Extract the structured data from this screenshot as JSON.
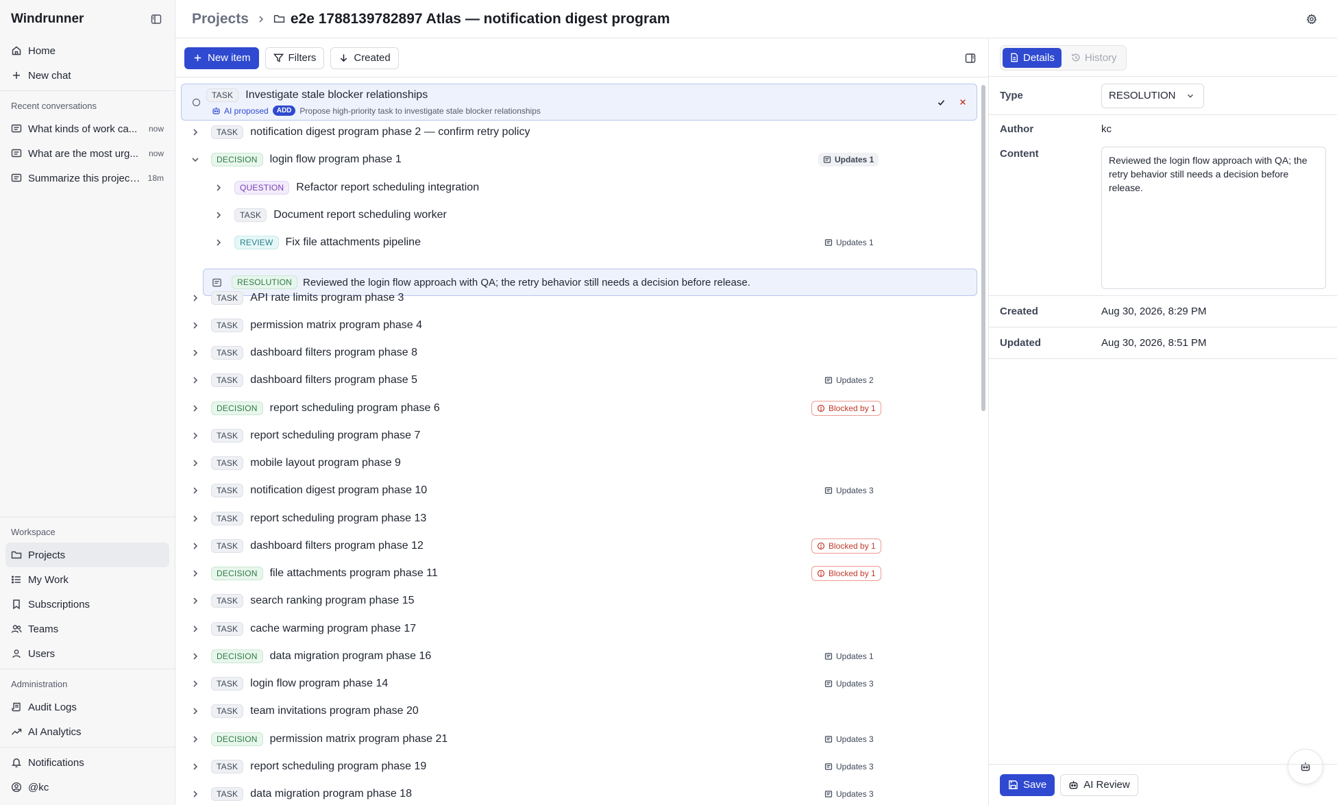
{
  "app": {
    "brand": "Windrunner"
  },
  "sidebar": {
    "home": "Home",
    "new_chat": "New chat",
    "recent_label": "Recent conversations",
    "conversations": [
      {
        "title": "What kinds of work ca...",
        "time": "now"
      },
      {
        "title": "What are the most urg...",
        "time": "now"
      },
      {
        "title": "Summarize this project ...",
        "time": "18m"
      }
    ],
    "workspace_label": "Workspace",
    "workspace": [
      "Projects",
      "My Work",
      "Subscriptions",
      "Teams",
      "Users"
    ],
    "admin_label": "Administration",
    "admin": [
      "Audit Logs",
      "AI Analytics"
    ],
    "notifications": "Notifications",
    "user": "@kc"
  },
  "header": {
    "root": "Projects",
    "title": "e2e 1788139782897 Atlas — notification digest program"
  },
  "toolbar": {
    "new_item": "New item",
    "filters": "Filters",
    "sort": "Created"
  },
  "proposal": {
    "type": "TASK",
    "title": "Investigate stale blocker relationships",
    "ai_label": "AI proposed",
    "action": "ADD",
    "description": "Propose high-priority task to investigate stale blocker relationships"
  },
  "items": [
    {
      "type": "TASK",
      "title": "notification digest program phase 2 — confirm retry policy",
      "meta": ""
    },
    {
      "type": "DECISION",
      "title": "login flow program phase 1",
      "meta": "Updates 1",
      "expanded": true
    },
    {
      "type": "QUESTION",
      "title": "Refactor report scheduling integration",
      "meta": "",
      "child": true
    },
    {
      "type": "TASK",
      "title": "Document report scheduling worker",
      "meta": "",
      "child": true
    },
    {
      "type": "REVIEW",
      "title": "Fix file attachments pipeline",
      "meta": "Updates 1",
      "child": true
    },
    {
      "type": "TASK",
      "title": "API rate limits program phase 3",
      "meta": ""
    },
    {
      "type": "TASK",
      "title": "permission matrix program phase 4",
      "meta": ""
    },
    {
      "type": "TASK",
      "title": "dashboard filters program phase 8",
      "meta": ""
    },
    {
      "type": "TASK",
      "title": "dashboard filters program phase 5",
      "meta": "Updates 2"
    },
    {
      "type": "DECISION",
      "title": "report scheduling program phase 6",
      "meta": "Blocked by 1"
    },
    {
      "type": "TASK",
      "title": "report scheduling program phase 7",
      "meta": ""
    },
    {
      "type": "TASK",
      "title": "mobile layout program phase 9",
      "meta": ""
    },
    {
      "type": "TASK",
      "title": "notification digest program phase 10",
      "meta": "Updates 3"
    },
    {
      "type": "TASK",
      "title": "report scheduling program phase 13",
      "meta": ""
    },
    {
      "type": "TASK",
      "title": "dashboard filters program phase 12",
      "meta": "Blocked by 1"
    },
    {
      "type": "DECISION",
      "title": "file attachments program phase 11",
      "meta": "Blocked by 1"
    },
    {
      "type": "TASK",
      "title": "search ranking program phase 15",
      "meta": ""
    },
    {
      "type": "TASK",
      "title": "cache warming program phase 17",
      "meta": ""
    },
    {
      "type": "DECISION",
      "title": "data migration program phase 16",
      "meta": "Updates 1"
    },
    {
      "type": "TASK",
      "title": "login flow program phase 14",
      "meta": "Updates 3"
    },
    {
      "type": "TASK",
      "title": "team invitations program phase 20",
      "meta": ""
    },
    {
      "type": "DECISION",
      "title": "permission matrix program phase 21",
      "meta": "Updates 3"
    },
    {
      "type": "TASK",
      "title": "report scheduling program phase 19",
      "meta": "Updates 3"
    },
    {
      "type": "TASK",
      "title": "data migration program phase 18",
      "meta": "Updates 3"
    }
  ],
  "resolution": {
    "type": "RESOLUTION",
    "text": "Reviewed the login flow approach with QA; the retry behavior still needs a decision before release."
  },
  "panel": {
    "tabs": {
      "details": "Details",
      "history": "History"
    },
    "type_label": "Type",
    "type_value": "RESOLUTION",
    "author_label": "Author",
    "author_value": "kc",
    "content_label": "Content",
    "content_value": "Reviewed the login flow approach with QA; the retry behavior still needs a decision before release.",
    "created_label": "Created",
    "created_value": "Aug 30, 2026, 8:29 PM",
    "updated_label": "Updated",
    "updated_value": "Aug 30, 2026, 8:51 PM",
    "save": "Save",
    "ai_review": "AI Review"
  },
  "colors": {
    "accent": "#2f4ad0",
    "blocked": "#c0392b",
    "decision": "#2c7a45"
  }
}
